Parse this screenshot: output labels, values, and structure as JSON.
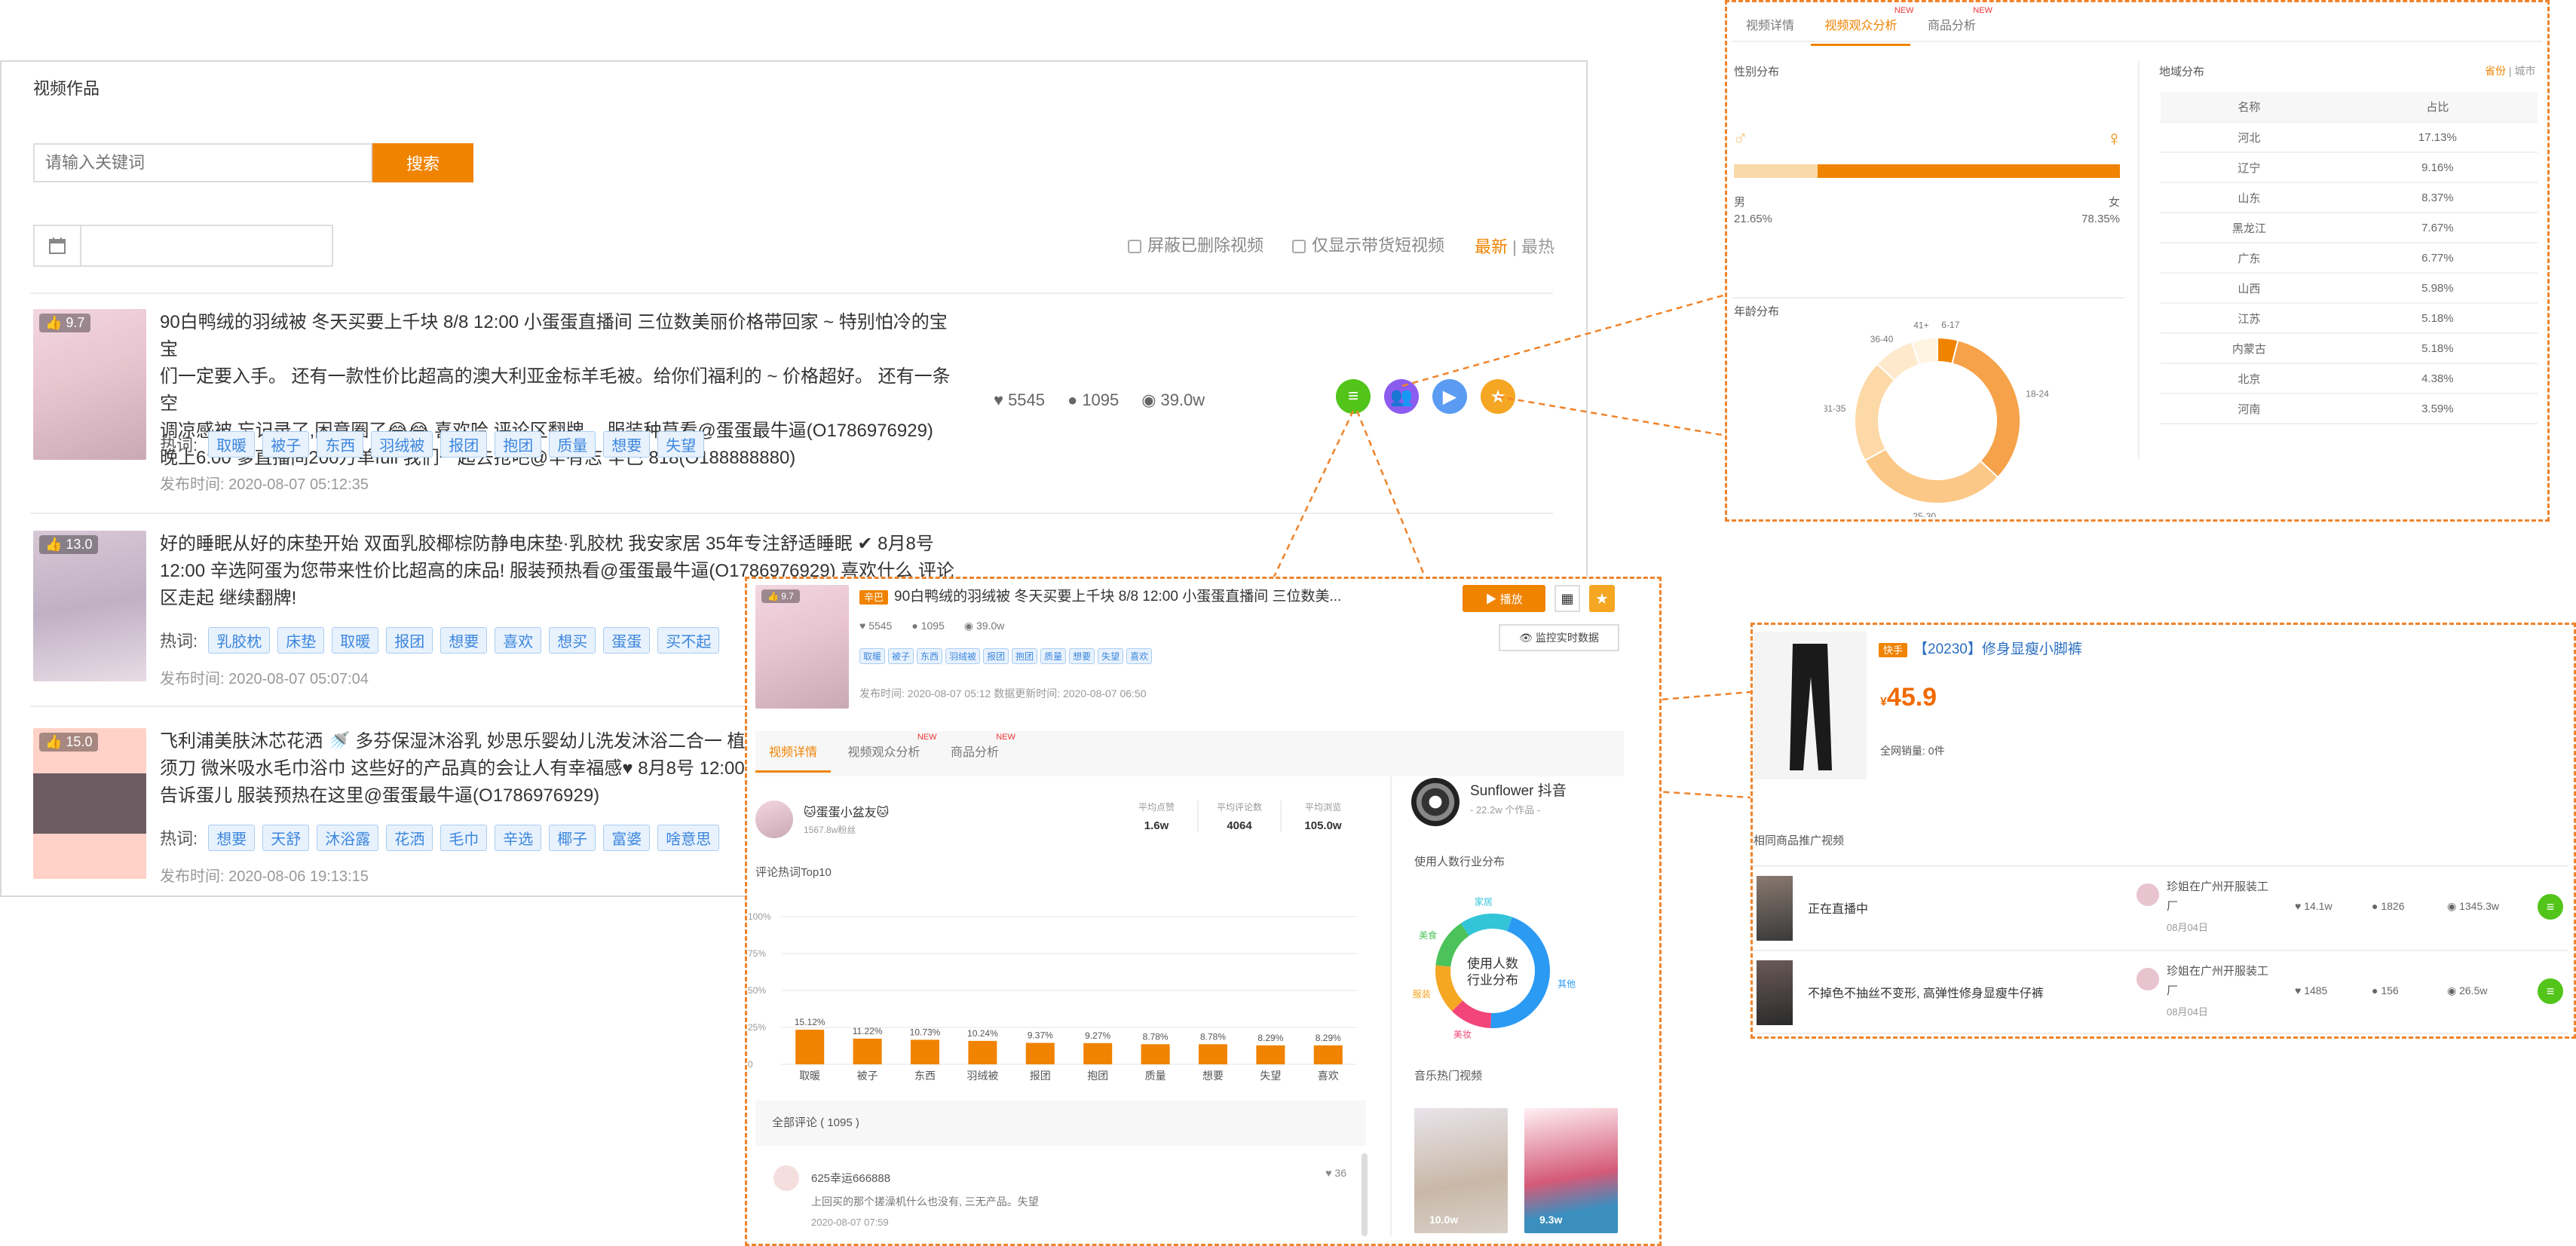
{
  "video_works": {
    "title": "视频作品",
    "search": {
      "placeholder": "请输入关键词",
      "button": "搜索"
    },
    "filters": {
      "hide_deleted": "屏蔽已删除视频",
      "only_goods": "仅显示带货短视频",
      "sort_latest": "最新",
      "sort_sep": "|",
      "sort_hot": "最热"
    },
    "hotwords_label": "热词:",
    "items": [
      {
        "score": "9.7",
        "title_l1": "90白鸭绒的羽绒被 冬天买要上千块 8/8 12:00 小蛋蛋直播间 三位数美丽价格带回家 ~ 特别怕冷的宝宝",
        "title_l2": "们一定要入手。 还有一款性价比超高的澳大利亚金标羊毛被。给你们福利的 ~ 价格超好。 还有一条空",
        "title_l3": "调凉感被,忘记录了,困意圈了😂😂 喜欢哈 评论区翻牌。 服装种草看@蛋蛋最牛逼(O1786976929)",
        "title_l4": "晚上6:00 爹直播间200万单full 我们一起去抢吧@辛有志 辛巴 818(O188888880)",
        "likes": "5545",
        "comments": "1095",
        "views": "39.0w",
        "tags": [
          "取暖",
          "被子",
          "东西",
          "羽绒被",
          "报团",
          "抱团",
          "质量",
          "想要",
          "失望"
        ],
        "time": "发布时间: 2020-08-07 05:12:35"
      },
      {
        "score": "13.0",
        "title_l1": "好的睡眠从好的床垫开始 双面乳胶椰棕防静电床垫·乳胶枕 我安家居 35年专注舒适睡眠 ✔ 8月8号",
        "title_l2": "12:00 辛选阿蛋为您带来性价比超高的床品! 服装预热看@蛋蛋最牛逼(O1786976929) 喜欢什么 评论",
        "title_l3": "区走起 继续翻牌!",
        "likes": "",
        "comments": "",
        "views": "",
        "tags": [
          "乳胶枕",
          "床垫",
          "取暖",
          "报团",
          "想要",
          "喜欢",
          "想买",
          "蛋蛋",
          "买不起"
        ],
        "time": "发布时间: 2020-08-07 05:07:04"
      },
      {
        "score": "15.0",
        "title_l1": "飞利浦美肤沐芯花洒 🚿 多芬保湿沐浴乳 妙思乐婴幼儿洗发沐浴二合一 植观",
        "title_l2": "须刀 微米吸水毛巾浴巾 这些好的产品真的会让人有幸福感♥ 8月8号 12:00 辛",
        "title_l3": "告诉蛋儿 服装预热在这里@蛋蛋最牛逼(O1786976929)",
        "likes": "",
        "comments": "",
        "views": "",
        "tags": [
          "想要",
          "天舒",
          "沐浴露",
          "花洒",
          "毛巾",
          "辛选",
          "椰子",
          "富婆",
          "啥意思"
        ],
        "time": "发布时间: 2020-08-06 19:13:15"
      }
    ],
    "actions": [
      "list-icon",
      "users-icon",
      "play-icon",
      "star-icon"
    ]
  },
  "audience": {
    "tabs": [
      "视频详情",
      "视频观众分析",
      "商品分析"
    ],
    "new_label": "NEW",
    "gender": {
      "title": "性别分布",
      "male_label": "男",
      "male_pct": "21.65%",
      "female_label": "女",
      "female_pct": "78.35%",
      "male_value": 21.65
    },
    "age": {
      "title": "年龄分布",
      "segments": [
        {
          "label": "6-17",
          "value": 4
        },
        {
          "label": "18-24",
          "value": 33
        },
        {
          "label": "25-30",
          "value": 30
        },
        {
          "label": "31-35",
          "value": 20
        },
        {
          "label": "36-40",
          "value": 8
        },
        {
          "label": "41+",
          "value": 5
        }
      ]
    },
    "region": {
      "title": "地域分布",
      "opt_province": "省份",
      "opt_sep": "|",
      "opt_city": "城市",
      "col_name": "名称",
      "col_pct": "占比",
      "rows": [
        [
          "河北",
          "17.13%"
        ],
        [
          "辽宁",
          "9.16%"
        ],
        [
          "山东",
          "8.37%"
        ],
        [
          "黑龙江",
          "7.67%"
        ],
        [
          "广东",
          "6.77%"
        ],
        [
          "山西",
          "5.98%"
        ],
        [
          "江苏",
          "5.18%"
        ],
        [
          "内蒙古",
          "5.18%"
        ],
        [
          "北京",
          "4.38%"
        ],
        [
          "河南",
          "3.59%"
        ]
      ]
    }
  },
  "detail": {
    "tag": "辛巴",
    "title": "90白鸭绒的羽绒被 冬天买要上千块 8/8 12:00 小蛋蛋直播间 三位数美...",
    "likes": "5545",
    "comments": "1095",
    "views": "39.0w",
    "tags": [
      "取暖",
      "被子",
      "东西",
      "羽绒被",
      "报团",
      "抱团",
      "质量",
      "想要",
      "失望",
      "喜欢"
    ],
    "time": "发布时间: 2020-08-07 05:12 数据更新时间: 2020-08-07 06:50",
    "play_btn": "播放",
    "monitor_btn": "监控实时数据",
    "tabs": [
      "视频详情",
      "视频观众分析",
      "商品分析"
    ],
    "author": {
      "name": "🐱蛋蛋小盆友🐱",
      "fans": "1567.8w粉丝"
    },
    "avg": [
      {
        "label": "平均点赞",
        "value": "1.6w"
      },
      {
        "label": "平均评论数",
        "value": "4064"
      },
      {
        "label": "平均浏览",
        "value": "105.0w"
      }
    ],
    "music": {
      "name": "Sunflower 抖音",
      "sub": "- 22.2w 个作品 -"
    },
    "industry": {
      "title": "使用人数行业分布",
      "center_l1": "使用人数",
      "center_l2": "行业分布",
      "labels": [
        "其他",
        "美妆",
        "服装",
        "美食",
        "家居"
      ]
    },
    "music_hot": "音乐热门视频",
    "music_views": [
      "10.0w",
      "9.3w"
    ],
    "top10": {
      "title": "评论热词Top10",
      "axis": [
        "100%",
        "75%",
        "50%",
        "25%",
        "0"
      ]
    },
    "all_comments": "全部评论 ( 1095 )",
    "comment": {
      "user": "625幸运666888",
      "likes": "36",
      "text": "上回买的那个搓澡机什么也没有, 三无产品。失望",
      "time": "2020-08-07 07:59"
    }
  },
  "chart_data": {
    "type": "bar",
    "categories": [
      "取暖",
      "被子",
      "东西",
      "羽绒被",
      "报团",
      "抱团",
      "质量",
      "想要",
      "失望",
      "喜欢"
    ],
    "values": [
      15.12,
      11.22,
      10.73,
      10.24,
      9.37,
      9.27,
      8.78,
      8.78,
      8.29,
      8.29
    ],
    "labels": [
      "15.12%",
      "11.22%",
      "10.73%",
      "10.24%",
      "9.37%",
      "9.27%",
      "8.78%",
      "8.78%",
      "8.29%",
      "8.29%"
    ],
    "title": "评论热词Top10",
    "ylim": [
      0,
      100
    ]
  },
  "product": {
    "tag": "快手",
    "title": "【20230】修身显瘦小脚裤",
    "price_sym": "¥",
    "price": "45.9",
    "sales_label": "全网销量:",
    "sales": "0件",
    "related_title": "相同商品推广视频",
    "rows": [
      {
        "title": "正在直播中",
        "shop": "珍姐在广州开服装工厂",
        "date": "08月04日",
        "likes": "14.1w",
        "comments": "1826",
        "views": "1345.3w"
      },
      {
        "title": "不掉色不抽丝不变形, 高弹性修身显瘦牛仔裤",
        "shop": "珍姐在广州开服装工厂",
        "date": "08月04日",
        "likes": "1485",
        "comments": "156",
        "views": "26.5w"
      }
    ]
  }
}
